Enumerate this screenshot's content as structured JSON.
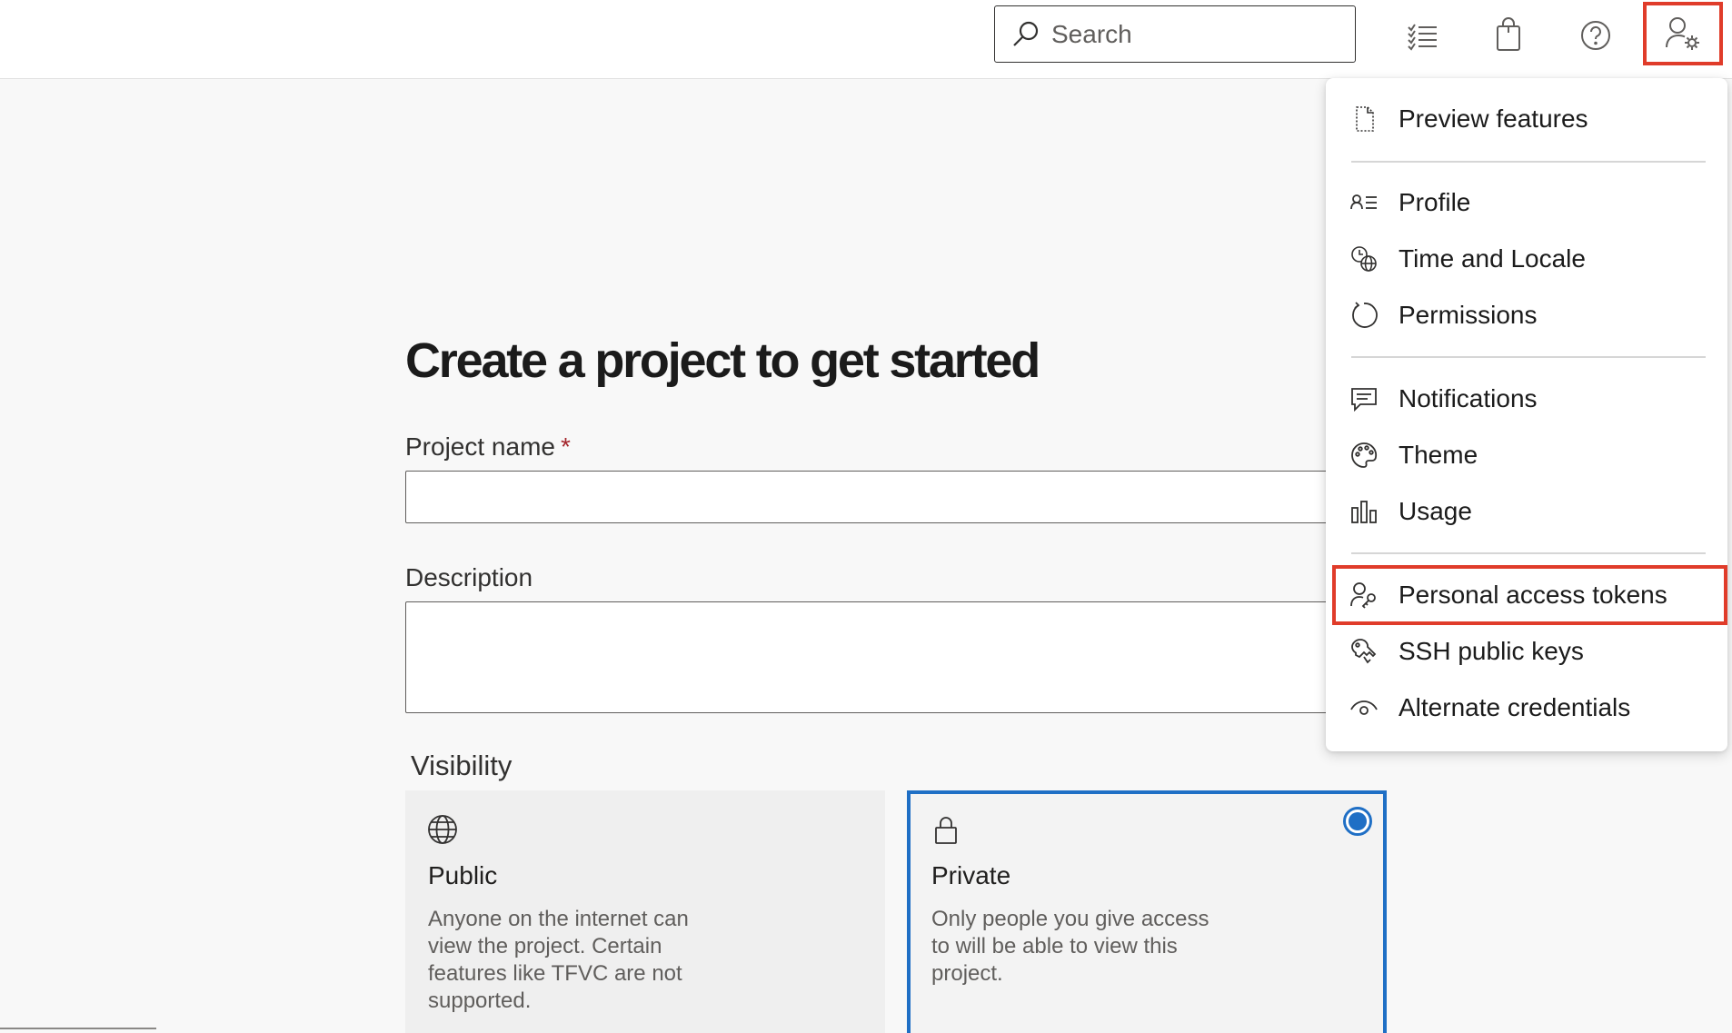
{
  "topbar": {
    "search": {
      "placeholder": "Search",
      "value": "",
      "icon": "search-icon"
    },
    "icons": [
      "task-list-icon",
      "marketplace-bag-icon",
      "help-icon",
      "user-settings-icon"
    ]
  },
  "main": {
    "title": "Create a project to get started",
    "project_name": {
      "label": "Project name",
      "required_marker": "*",
      "value": ""
    },
    "description": {
      "label": "Description",
      "value": ""
    },
    "visibility": {
      "label": "Visibility",
      "options": [
        {
          "title": "Public",
          "icon": "globe-icon",
          "description": "Anyone on the internet can view the project. Certain features like TFVC are not supported.",
          "selected": false
        },
        {
          "title": "Private",
          "icon": "lock-icon",
          "description": "Only people you give access to will be able to view this project.",
          "selected": true
        }
      ]
    }
  },
  "user_menu": {
    "items": [
      {
        "label": "Preview features",
        "icon": "preview-document-icon"
      },
      {
        "label": "Profile",
        "icon": "profile-card-icon"
      },
      {
        "label": "Time and Locale",
        "icon": "clock-globe-icon"
      },
      {
        "label": "Permissions",
        "icon": "refresh-circle-icon"
      },
      {
        "label": "Notifications",
        "icon": "chat-message-icon"
      },
      {
        "label": "Theme",
        "icon": "palette-icon"
      },
      {
        "label": "Usage",
        "icon": "bar-chart-icon"
      },
      {
        "label": "Personal access tokens",
        "icon": "person-key-icon",
        "highlighted": true
      },
      {
        "label": "SSH public keys",
        "icon": "ssh-key-icon"
      },
      {
        "label": "Alternate credentials",
        "icon": "eye-icon"
      }
    ]
  },
  "colors": {
    "highlight": "#e03c2a",
    "accent": "#1f6fc5",
    "required": "#a4262c"
  }
}
